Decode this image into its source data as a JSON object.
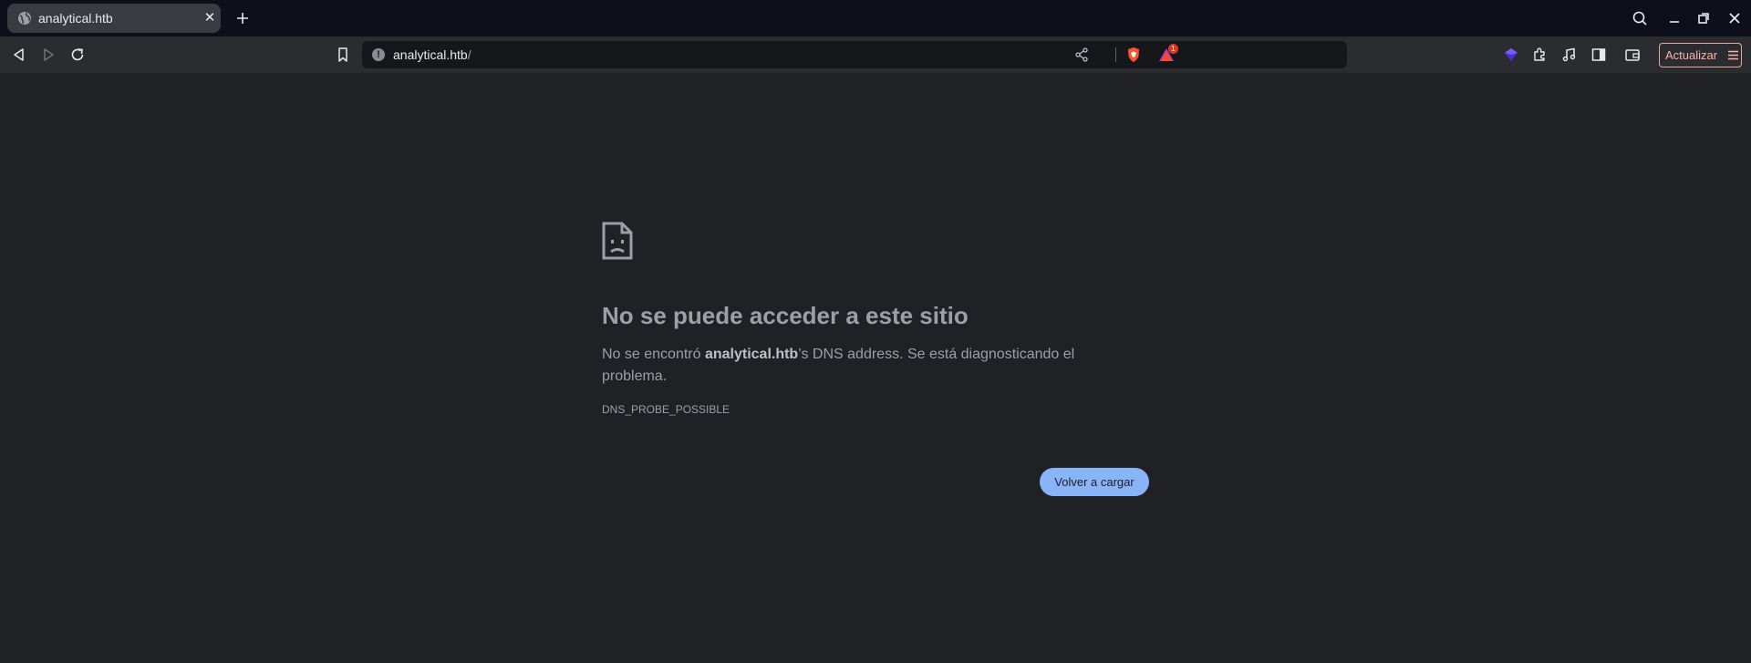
{
  "tab": {
    "title": "analytical.htb",
    "close_glyph": "✕",
    "favicon": "globe-icon"
  },
  "omnibox": {
    "host": "analytical.htb",
    "path": "/",
    "info_glyph": "!"
  },
  "notification_badge": "1",
  "update_button": {
    "label": "Actualizar"
  },
  "error": {
    "title": "No se puede acceder a este sitio",
    "desc_prefix": "No se encontró ",
    "desc_host": "analytical.htb",
    "desc_suffix": "’s DNS address. Se está diagnosticando el problema.",
    "code": "DNS_PROBE_POSSIBLE"
  },
  "reload_button": {
    "label": "Volver a cargar"
  },
  "colors": {
    "tabstrip_bg": "#0d0f1a",
    "toolbar_bg": "#2b2c30",
    "page_bg": "#202124",
    "accent_button": "#8ab4f8",
    "brave_orange": "#fb542b",
    "update_border": "#e8a898"
  }
}
